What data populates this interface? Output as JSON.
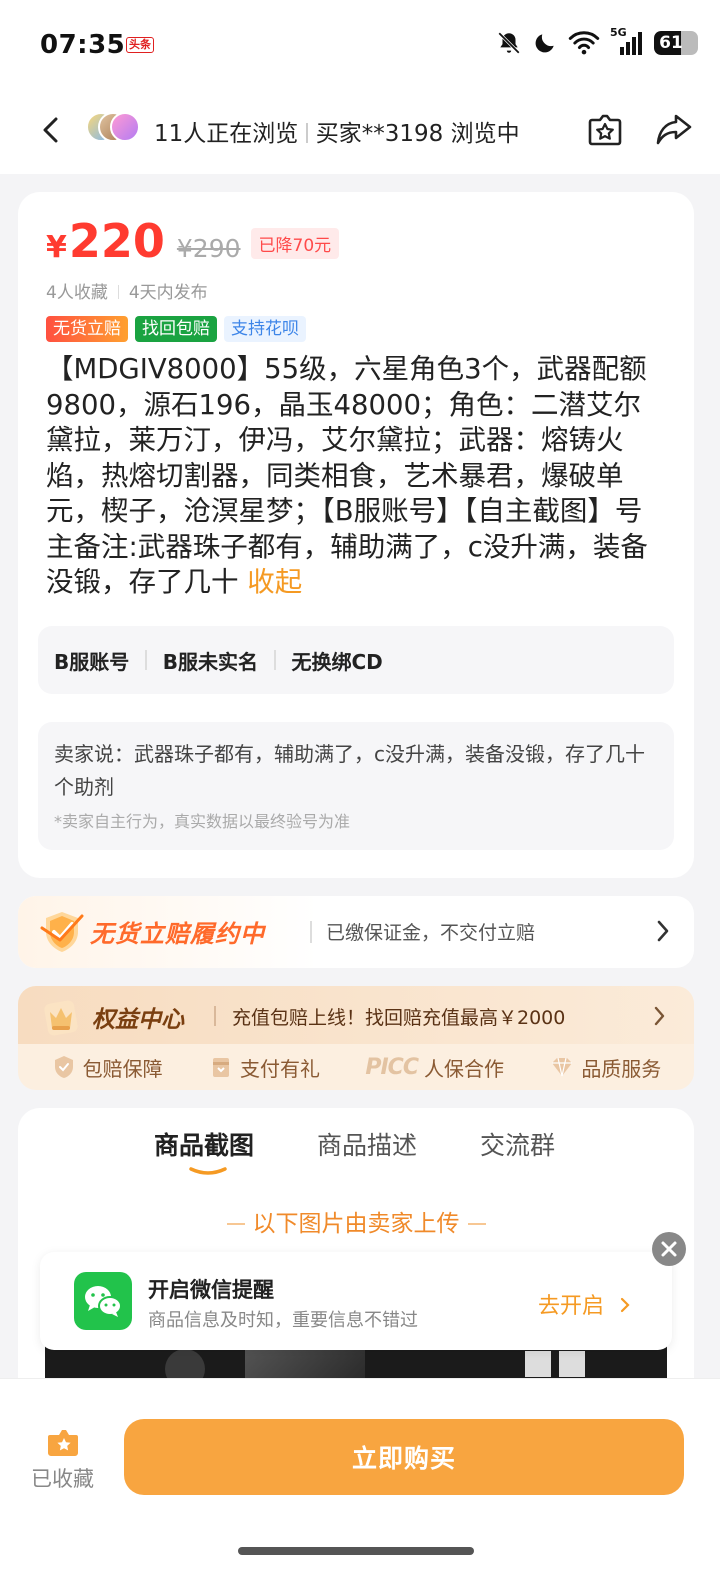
{
  "status_bar": {
    "time": "07:35",
    "app_badge": "头条",
    "network": "5G",
    "battery": "61",
    "battery_level": 0.61
  },
  "nav": {
    "viewers": "11人正在浏览",
    "buyer_viewing": "买家**3198 浏览中"
  },
  "product": {
    "currency": "¥",
    "price": "220",
    "original_price": "¥290",
    "price_drop": "已降70元",
    "favorites": "4人收藏",
    "published": "4天内发布",
    "tags": [
      "无货立赔",
      "找回包赔",
      "支持花呗"
    ],
    "title": "【MDGIV8000】55级，六星角色3个，武器配额9800，源石196，晶玉48000；角色：二潜艾尔黛拉，莱万汀，伊冯，艾尔黛拉；武器：熔铸火焰，热熔切割器，同类相食，艺术暴君，爆破单元，楔子，沧溟星梦；【B服账号】【自主截图】号主备注:武器珠子都有，辅助满了，c没升满，装备没锻，存了几十",
    "collapse_label": "收起",
    "attributes": [
      "B服账号",
      "B服未实名",
      "无换绑CD"
    ],
    "seller_says": "卖家说：武器珠子都有，辅助满了，c没升满，装备没锻，存了几十个助剂",
    "seller_note": "*卖家自主行为，真实数据以最终验号为准"
  },
  "promise": {
    "title": "无货立赔履约中",
    "desc": "已缴保证金，不交付立赔"
  },
  "rights": {
    "title": "权益中心",
    "desc": "充值包赔上线！找回赔充值最高￥2000",
    "items": [
      "包赔保障",
      "支付有礼",
      "人保合作",
      "品质服务"
    ],
    "picc_logo": "PICC"
  },
  "tabs": {
    "items": [
      "商品截图",
      "商品描述",
      "交流群"
    ],
    "active": "商品截图"
  },
  "upload_note": "以下图片由卖家上传",
  "wechat": {
    "title": "开启微信提醒",
    "subtitle": "商品信息及时知，重要信息不错过",
    "cta": "去开启"
  },
  "bottom": {
    "saved_label": "已收藏",
    "buy_label": "立即购买"
  },
  "colors": {
    "accent": "#f8a540",
    "price": "#ff3b30",
    "wechat": "#22c34b"
  }
}
